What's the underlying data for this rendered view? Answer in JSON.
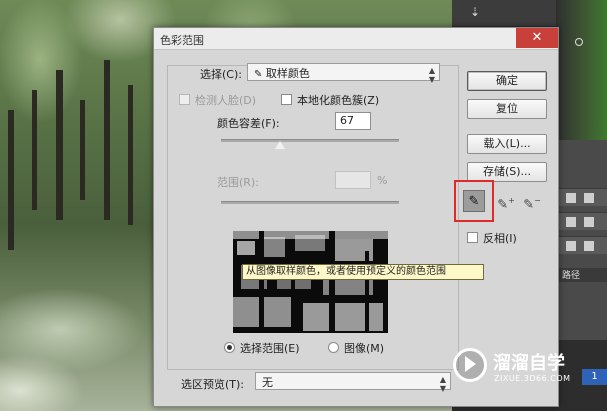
{
  "dialog": {
    "title": "色彩范围",
    "close_glyph": "✕"
  },
  "select": {
    "label": "选择(C):",
    "value": "取样颜色",
    "value_icon": "eyedropper-icon"
  },
  "options": {
    "detect_faces_label": "检测人脸(D)",
    "detect_faces_checked": false,
    "localized_clusters_label": "本地化颜色簇(Z)",
    "localized_clusters_checked": false
  },
  "fuzziness": {
    "label": "颜色容差(F):",
    "value": "67",
    "slider_fraction": 0.335
  },
  "range": {
    "label": "范围(R):",
    "value": "",
    "unit": "%",
    "slider_fraction": 1.0
  },
  "preview": {
    "tooltip": "从图像取样颜色，或者使用预定义的颜色范围",
    "radio_selection_label": "选择范围(E)",
    "radio_image_label": "图像(M)",
    "selected": "selection"
  },
  "selection_preview": {
    "label": "选区预览(T):",
    "value": "无"
  },
  "buttons": {
    "ok": "确定",
    "reset": "复位",
    "load": "载入(L)...",
    "save": "存储(S)..."
  },
  "tools": {
    "eyedropper": "eyedropper-icon",
    "add": "eyedropper-plus-icon",
    "subtract": "eyedropper-minus-icon"
  },
  "invert": {
    "label": "反相(I)",
    "checked": false
  },
  "photoshop_panel": {
    "layers_tab": "路径",
    "layer_number": "1"
  },
  "watermark": {
    "brand": "溜溜自学",
    "url": "ZIXUE.3D66.COM"
  },
  "colors": {
    "highlight": "#e02a2a",
    "close_button": "#c9403a",
    "tooltip_bg": "#fff8c8"
  }
}
